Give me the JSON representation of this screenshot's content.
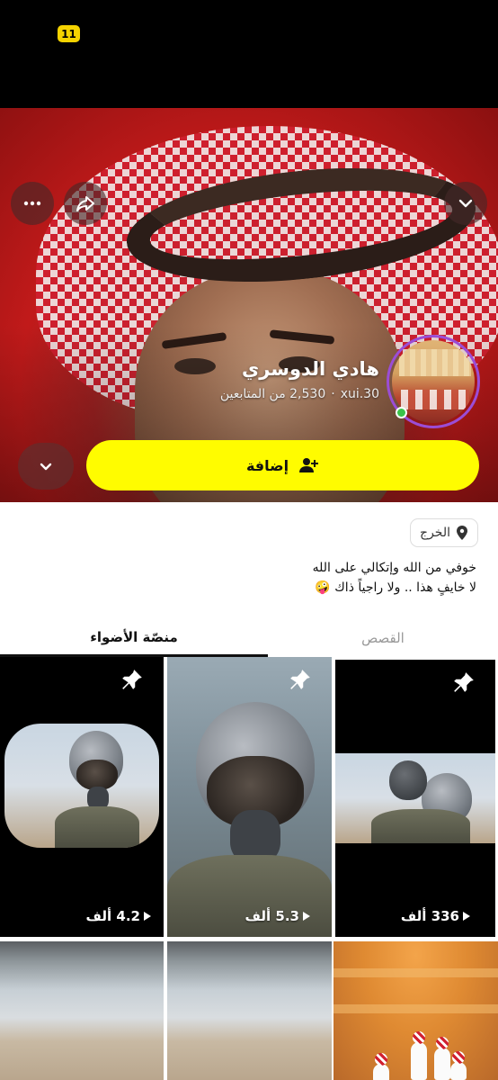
{
  "status_bar": {
    "badge": "11"
  },
  "profile": {
    "display_name": "هادي الدوسري",
    "username": "xui.30",
    "separator": "·",
    "followers": "2,530 من المتابعين"
  },
  "actions": {
    "add_label": "إضافة"
  },
  "location": "الخرج",
  "bio": {
    "line1": "خوفي من الله وإتكالي على الله",
    "line2": "لا خايفٍ هذا .. ولا راجياً ذاك 🤪"
  },
  "tabs": [
    {
      "label": "القصص",
      "active": false
    },
    {
      "label": "منصّة الأضواء",
      "active": true
    }
  ],
  "tiles": [
    {
      "views": "336 ألف",
      "pinned": true
    },
    {
      "views": "5.3 ألف",
      "pinned": true
    },
    {
      "views": "4.2 ألف",
      "pinned": true
    },
    {
      "views": "",
      "pinned": false
    },
    {
      "views": "",
      "pinned": false
    },
    {
      "views": "",
      "pinned": false
    }
  ],
  "colors": {
    "accent_yellow": "#fffc00",
    "story_ring": "#9b4dd6",
    "online": "#3ac34a"
  },
  "icons": [
    "more-icon",
    "share-icon",
    "chevron-down-icon",
    "add-friend-icon",
    "location-pin-icon",
    "pin-icon",
    "play-icon"
  ]
}
